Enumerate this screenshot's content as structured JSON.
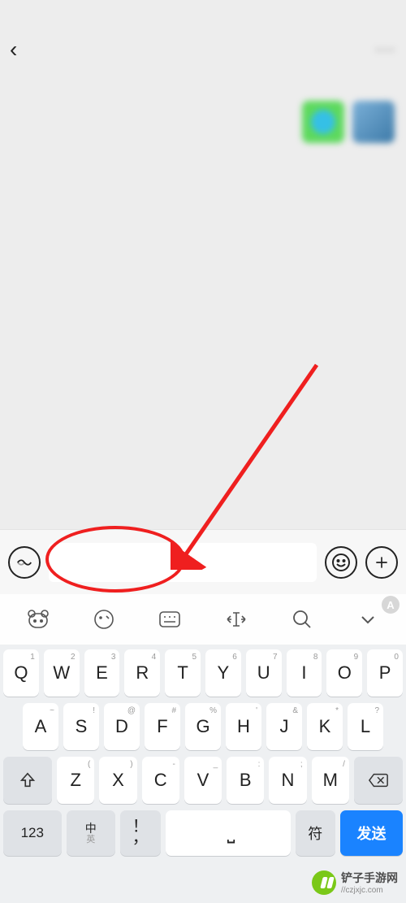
{
  "status": {
    "left": "",
    "right": ""
  },
  "nav": {
    "title": "",
    "more": "···"
  },
  "chat": {
    "date": ""
  },
  "keyboard": {
    "ai_badge": "A",
    "row1": [
      {
        "main": "Q",
        "sup": "1"
      },
      {
        "main": "W",
        "sup": "2"
      },
      {
        "main": "E",
        "sup": "3"
      },
      {
        "main": "R",
        "sup": "4"
      },
      {
        "main": "T",
        "sup": "5"
      },
      {
        "main": "Y",
        "sup": "6"
      },
      {
        "main": "U",
        "sup": "7"
      },
      {
        "main": "I",
        "sup": "8"
      },
      {
        "main": "O",
        "sup": "9"
      },
      {
        "main": "P",
        "sup": "0"
      }
    ],
    "row2": [
      {
        "main": "A",
        "sup": "~"
      },
      {
        "main": "S",
        "sup": "!"
      },
      {
        "main": "D",
        "sup": "@"
      },
      {
        "main": "F",
        "sup": "#"
      },
      {
        "main": "G",
        "sup": "%"
      },
      {
        "main": "H",
        "sup": "'"
      },
      {
        "main": "J",
        "sup": "&"
      },
      {
        "main": "K",
        "sup": "*"
      },
      {
        "main": "L",
        "sup": "?"
      }
    ],
    "row3": [
      {
        "main": "Z",
        "sup": "("
      },
      {
        "main": "X",
        "sup": ")"
      },
      {
        "main": "C",
        "sup": "-"
      },
      {
        "main": "V",
        "sup": "_"
      },
      {
        "main": "B",
        "sup": ":"
      },
      {
        "main": "N",
        "sup": ";"
      },
      {
        "main": "M",
        "sup": "/"
      }
    ],
    "k123": "123",
    "lang_top": "中",
    "lang_bot": "英",
    "punct_top": "！",
    "punct_bot": "，",
    "sym": "符",
    "send": "发送"
  },
  "watermark": {
    "text": "铲子手游网",
    "url": "//czjxjc.com"
  }
}
